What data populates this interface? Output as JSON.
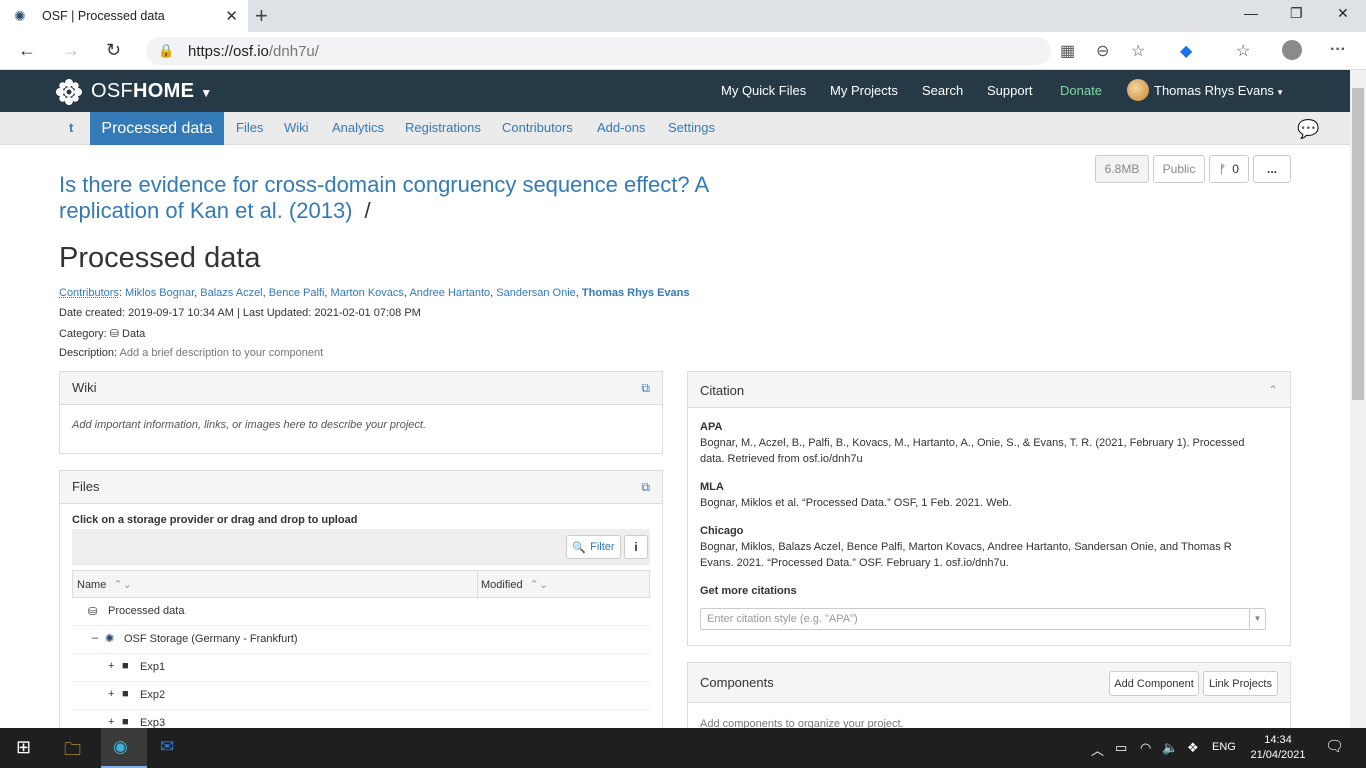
{
  "browser": {
    "tab_title": "OSF | Processed data",
    "url_host": "https://osf.io",
    "url_path": "/dnh7u/"
  },
  "osf": {
    "brand": "OSF",
    "brand_bold": "HOME",
    "nav": [
      "My Quick Files",
      "My Projects",
      "Search",
      "Support",
      "Donate"
    ],
    "user": "Thomas Rhys Evans"
  },
  "subnav": {
    "back": "t",
    "active": "Processed data",
    "items": [
      "Files",
      "Wiki",
      "Analytics",
      "Registrations",
      "Contributors",
      "Add-ons",
      "Settings"
    ]
  },
  "toolbar": {
    "size": "6.8MB",
    "visibility": "Public",
    "forks": "0",
    "more": "..."
  },
  "project": {
    "parent_title": "Is there evidence for cross-domain congruency sequence effect? A replication of Kan et al. (2013)",
    "title": "Processed data",
    "contributors_label": "Contributors",
    "contributors": [
      "Miklos Bognar",
      "Balazs Aczel",
      "Bence Palfi",
      "Marton Kovacs",
      "Andree Hartanto",
      "Sandersan Onie"
    ],
    "contributor_self": "Thomas Rhys Evans",
    "dates": "Date created: 2019-09-17 10:34 AM | Last Updated: 2021-02-01 07:08 PM",
    "category_label": "Category:",
    "category": "Data",
    "description_label": "Description:",
    "description": "Add a brief description to your component"
  },
  "wiki": {
    "title": "Wiki",
    "body": "Add important information, links, or images here to describe your project."
  },
  "files": {
    "title": "Files",
    "hint": "Click on a storage provider or drag and drop to upload",
    "filter": "Filter",
    "col_name": "Name",
    "col_modified": "Modified",
    "rows": [
      "Processed data",
      "OSF Storage (Germany - Frankfurt)",
      "Exp1",
      "Exp2",
      "Exp3"
    ]
  },
  "citation": {
    "title": "Citation",
    "apa_label": "APA",
    "apa": "Bognar, M., Aczel, B., Palfi, B., Kovacs, M., Hartanto, A., Onie, S., & Evans, T. R. (2021, February 1). Processed data. Retrieved from osf.io/dnh7u",
    "mla_label": "MLA",
    "mla": "Bognar, Miklos et al. “Processed Data.” OSF, 1 Feb. 2021. Web.",
    "chicago_label": "Chicago",
    "chicago": "Bognar, Miklos, Balazs Aczel, Bence Palfi, Marton Kovacs, Andree Hartanto, Sandersan Onie, and Thomas R Evans. 2021. “Processed Data.” OSF. February 1. osf.io/dnh7u.",
    "more_label": "Get more citations",
    "placeholder": "Enter citation style (e.g. \"APA\")"
  },
  "components": {
    "title": "Components",
    "add": "Add Component",
    "link": "Link Projects",
    "empty": "Add components to organize your project."
  },
  "taskbar": {
    "lang": "ENG",
    "time": "14:34",
    "date": "21/04/2021"
  }
}
